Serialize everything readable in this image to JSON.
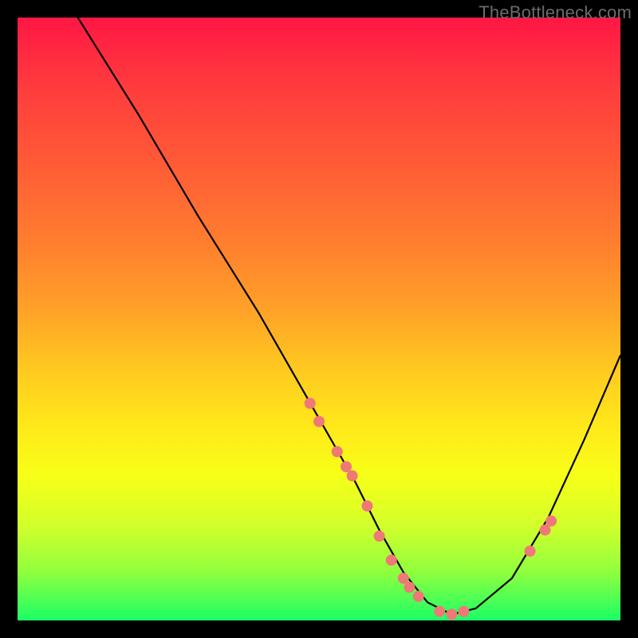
{
  "attribution": "TheBottleneck.com",
  "chart_data": {
    "type": "line",
    "title": "",
    "xlabel": "",
    "ylabel": "",
    "xlim": [
      0,
      100
    ],
    "ylim": [
      0,
      100
    ],
    "grid": false,
    "series": [
      {
        "name": "curve",
        "x": [
          10,
          20,
          30,
          40,
          48,
          56,
          60,
          64,
          68,
          72,
          76,
          82,
          88,
          94,
          100
        ],
        "y": [
          100,
          84,
          67,
          51,
          37,
          23,
          15,
          8,
          3,
          1,
          2,
          7,
          17,
          30,
          44
        ],
        "mode": "line",
        "color": "#000000"
      },
      {
        "name": "markers",
        "x": [
          48.5,
          50,
          53,
          54.5,
          55.5,
          58,
          60,
          62,
          64,
          65,
          66.5,
          70,
          72,
          74,
          85,
          87.5,
          88.5
        ],
        "y": [
          36,
          33,
          28,
          25.5,
          24,
          19,
          14,
          10,
          7,
          5.5,
          4,
          1.5,
          1,
          1.5,
          11.5,
          15,
          16.5
        ],
        "mode": "markers",
        "color": "#f07878"
      }
    ]
  }
}
